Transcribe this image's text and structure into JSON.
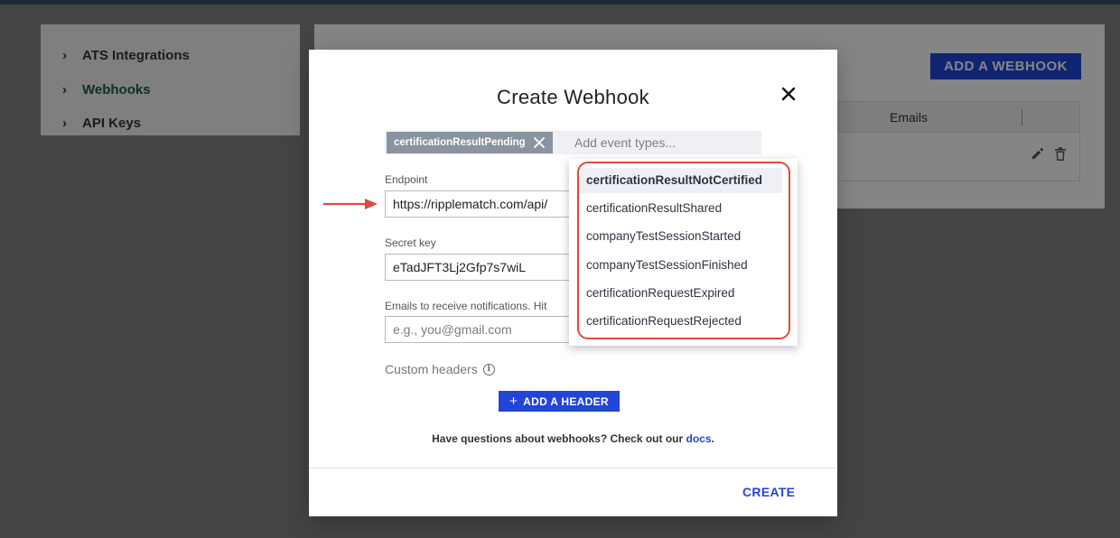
{
  "sidebar": {
    "items": [
      {
        "label": "ATS Integrations"
      },
      {
        "label": "Webhooks"
      },
      {
        "label": "API Keys"
      }
    ]
  },
  "page": {
    "add_webhook_label": "ADD A WEBHOOK",
    "table": {
      "col_emails": "Emails"
    }
  },
  "modal": {
    "title": "Create Webhook",
    "event_chip": "certificationResultPending",
    "event_placeholder": "Add event types...",
    "endpoint_label": "Endpoint",
    "endpoint_value": "https://ripplematch.com/api/",
    "secret_label": "Secret key",
    "secret_value": "eTadJFT3Lj2Gfp7s7wiL",
    "emails_label": "Emails to receive notifications. Hit",
    "emails_placeholder": "e.g., you@gmail.com",
    "custom_headers_label": "Custom headers",
    "add_header_label": "ADD A HEADER",
    "help_prefix": "Have questions about webhooks? Check out our ",
    "help_link": "docs",
    "help_suffix": ".",
    "create_label": "CREATE"
  },
  "dropdown": {
    "options": [
      "certificationResultNotCertified",
      "certificationResultShared",
      "companyTestSessionStarted",
      "companyTestSessionFinished",
      "certificationRequestExpired",
      "certificationRequestRejected"
    ]
  },
  "colors": {
    "primary": "#2245d8",
    "highlight": "#e04a3a",
    "active_nav": "#1f5a46"
  }
}
